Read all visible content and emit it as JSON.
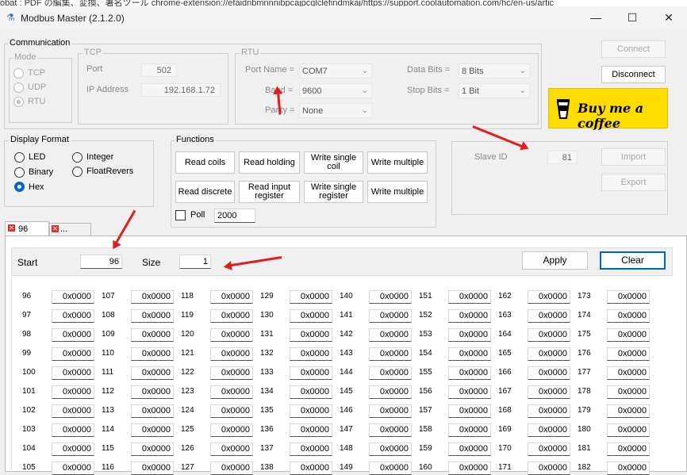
{
  "browser_strip": {
    "text": "obat : PDF の編集、変換、署名ツール    chrome-extension://efaidnbmnnnibpcajpcglclefindmkaj/https://support.coolautomation.com/hc/en-us/artic"
  },
  "window": {
    "title": "Modbus Master (2.1.2.0)",
    "minimize": "—",
    "maximize": "☐",
    "close": "✕"
  },
  "communication": {
    "label": "Communication",
    "mode": {
      "label": "Mode",
      "options": [
        "TCP",
        "UDP",
        "RTU"
      ],
      "selected": "RTU"
    },
    "tcp": {
      "label": "TCP",
      "port_label": "Port",
      "port": "502",
      "ip_label": "IP Address",
      "ip": "192.168.1.72"
    },
    "rtu": {
      "label": "RTU",
      "port_name_label": "Port Name =",
      "port_name": "COM7",
      "baud_label": "Baud =",
      "baud": "9600",
      "parity_label": "Parity =",
      "parity": "None",
      "data_bits_label": "Data Bits =",
      "data_bits": "8 Bits",
      "stop_bits_label": "Stop Bits =",
      "stop_bits": "1 Bit"
    }
  },
  "right_buttons": {
    "connect": "Connect",
    "disconnect": "Disconnect",
    "coffee": "Buy me a coffee",
    "slave_id_label": "Slave ID",
    "slave_id": "81",
    "import": "Import",
    "export": "Export"
  },
  "display_format": {
    "label": "Display Format",
    "options": [
      "LED",
      "Binary",
      "Hex",
      "Integer",
      "FloatRevers"
    ],
    "selected": "Hex"
  },
  "functions": {
    "label": "Functions",
    "buttons": [
      "Read coils",
      "Read holding",
      "Write single coil",
      "Write multiple",
      "Read discrete",
      "Read input register",
      "Write single register",
      "Write multiple"
    ],
    "poll_label": "Poll",
    "poll_value": "2000"
  },
  "tabs": [
    "96",
    "..."
  ],
  "register_panel": {
    "start_label": "Start",
    "start": "96",
    "size_label": "Size",
    "size": "1",
    "apply": "Apply",
    "clear": "Clear"
  },
  "registers": {
    "columns": [
      {
        "addresses": [
          "96",
          "97",
          "98",
          "99",
          "100",
          "101",
          "102",
          "103",
          "104",
          "105"
        ]
      },
      {
        "addresses": [
          "107",
          "108",
          "109",
          "110",
          "111",
          "112",
          "113",
          "114",
          "115",
          "116"
        ]
      },
      {
        "addresses": [
          "118",
          "119",
          "120",
          "121",
          "122",
          "123",
          "124",
          "125",
          "126",
          "127"
        ]
      },
      {
        "addresses": [
          "129",
          "130",
          "131",
          "132",
          "133",
          "134",
          "135",
          "136",
          "137",
          "138"
        ]
      },
      {
        "addresses": [
          "140",
          "141",
          "142",
          "143",
          "144",
          "145",
          "146",
          "147",
          "148",
          "149"
        ]
      },
      {
        "addresses": [
          "151",
          "152",
          "153",
          "154",
          "155",
          "156",
          "157",
          "158",
          "159",
          "160"
        ]
      },
      {
        "addresses": [
          "162",
          "163",
          "164",
          "165",
          "166",
          "167",
          "168",
          "169",
          "170",
          "171"
        ]
      },
      {
        "addresses": [
          "173",
          "174",
          "175",
          "176",
          "177",
          "178",
          "179",
          "180",
          "181",
          "182"
        ]
      }
    ],
    "value": "0x0000"
  },
  "colors": {
    "coffee_bg": "#ffdd00",
    "arrow": "#e01e1e",
    "accent": "#0067c0"
  }
}
